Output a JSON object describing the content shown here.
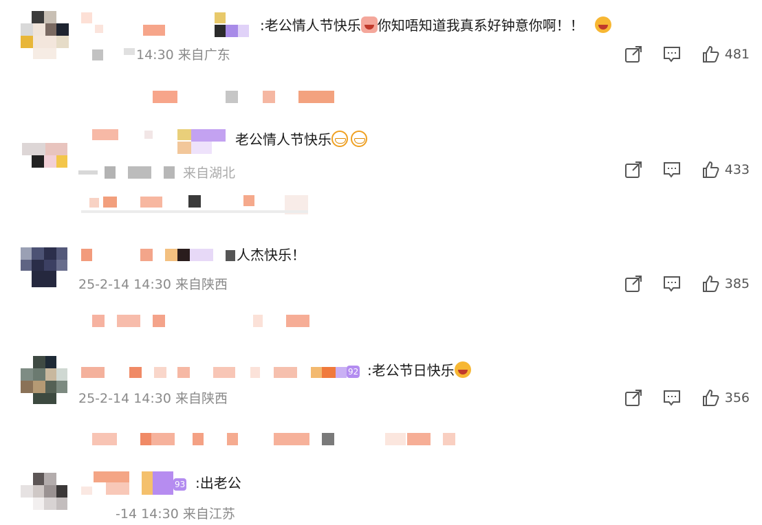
{
  "comments": [
    {
      "text": ":老公情人节快乐",
      "text_suffix": "你知唔知道我真系好钟意你啊！！",
      "meta": "14:30 来自广东",
      "likes": "481"
    },
    {
      "text": "老公情人节快乐",
      "meta": "来自湖北",
      "likes": "433"
    },
    {
      "text": "人杰快乐！",
      "meta": "25-2-14 14:30 来自陕西",
      "likes": "385"
    },
    {
      "text": ":老公节日快乐",
      "badge": "92",
      "meta": "25-2-14 14:30 来自陕西",
      "likes": "356"
    },
    {
      "text": ":出老公",
      "badge": "93",
      "meta": "-14 14:30 来自江苏"
    }
  ],
  "icons": {
    "share": "share-icon",
    "comment": "comment-icon",
    "like": "thumbs-up-icon"
  },
  "colors": {
    "accent": "#b38cf0",
    "meta": "#8a8a8a"
  }
}
